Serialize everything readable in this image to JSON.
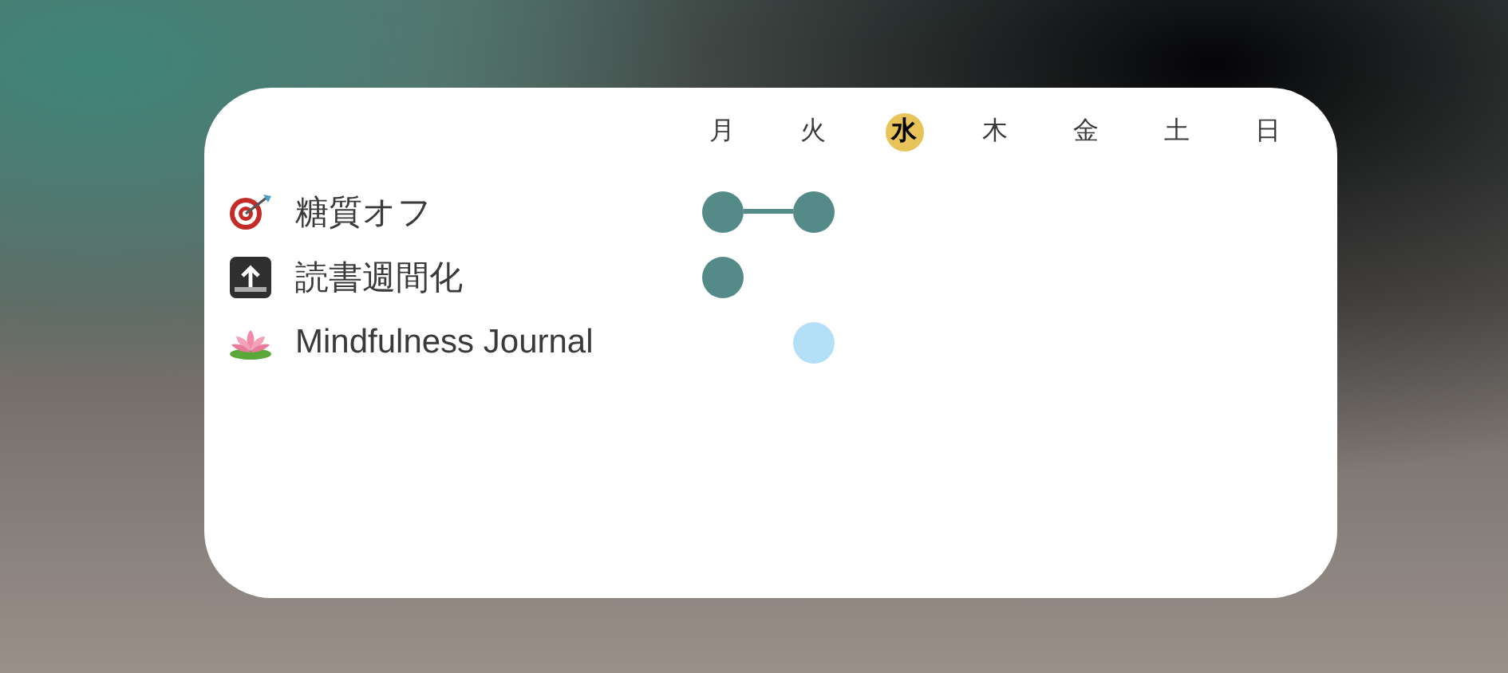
{
  "days": [
    {
      "label": "月",
      "selected": false
    },
    {
      "label": "火",
      "selected": false
    },
    {
      "label": "水",
      "selected": true
    },
    {
      "label": "木",
      "selected": false
    },
    {
      "label": "金",
      "selected": false
    },
    {
      "label": "土",
      "selected": false
    },
    {
      "label": "日",
      "selected": false
    }
  ],
  "habits": [
    {
      "name": "糖質オフ",
      "color": "#548a88",
      "days": [
        true,
        true,
        false,
        false,
        false,
        false,
        false
      ]
    },
    {
      "name": "読書週間化",
      "color": "#548a88",
      "days": [
        true,
        false,
        false,
        false,
        false,
        false,
        false
      ]
    },
    {
      "name": "Mindfulness Journal",
      "color": "#b3dff7",
      "days": [
        false,
        true,
        false,
        false,
        false,
        false,
        false
      ]
    }
  ]
}
